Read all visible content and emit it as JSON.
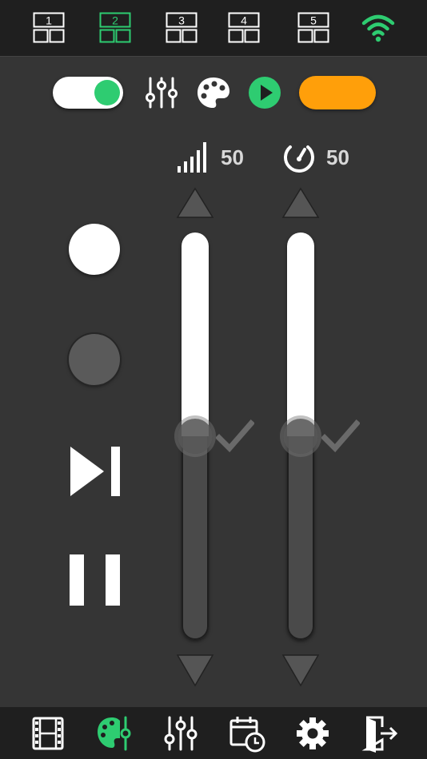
{
  "app": {
    "accent": "#2ecc71",
    "orange": "#ff9f0a"
  },
  "top_bar": {
    "layouts": [
      {
        "label": "1",
        "active": false
      },
      {
        "label": "2",
        "active": true
      },
      {
        "label": "3",
        "active": false
      },
      {
        "label": "4",
        "active": false
      },
      {
        "label": "5",
        "active": false
      }
    ],
    "wifi_icon": "wifi-icon"
  },
  "controls": {
    "toggle_on": true,
    "tools": [
      "sliders-icon",
      "palette-icon",
      "play-icon"
    ],
    "orange_button_color": "#ff9f0a"
  },
  "sliders": {
    "signal": {
      "icon": "signal-strength-icon",
      "value": "50",
      "level": 0.5
    },
    "speed": {
      "icon": "speedometer-icon",
      "value": "50",
      "level": 0.5
    }
  },
  "left_buttons": [
    "record-white-button",
    "record-gray-button",
    "skip-next-button",
    "pause-button"
  ],
  "bottom_nav": [
    "film-icon",
    "palette-icon",
    "sliders-icon",
    "calendar-clock-icon",
    "gear-icon",
    "exit-icon"
  ]
}
